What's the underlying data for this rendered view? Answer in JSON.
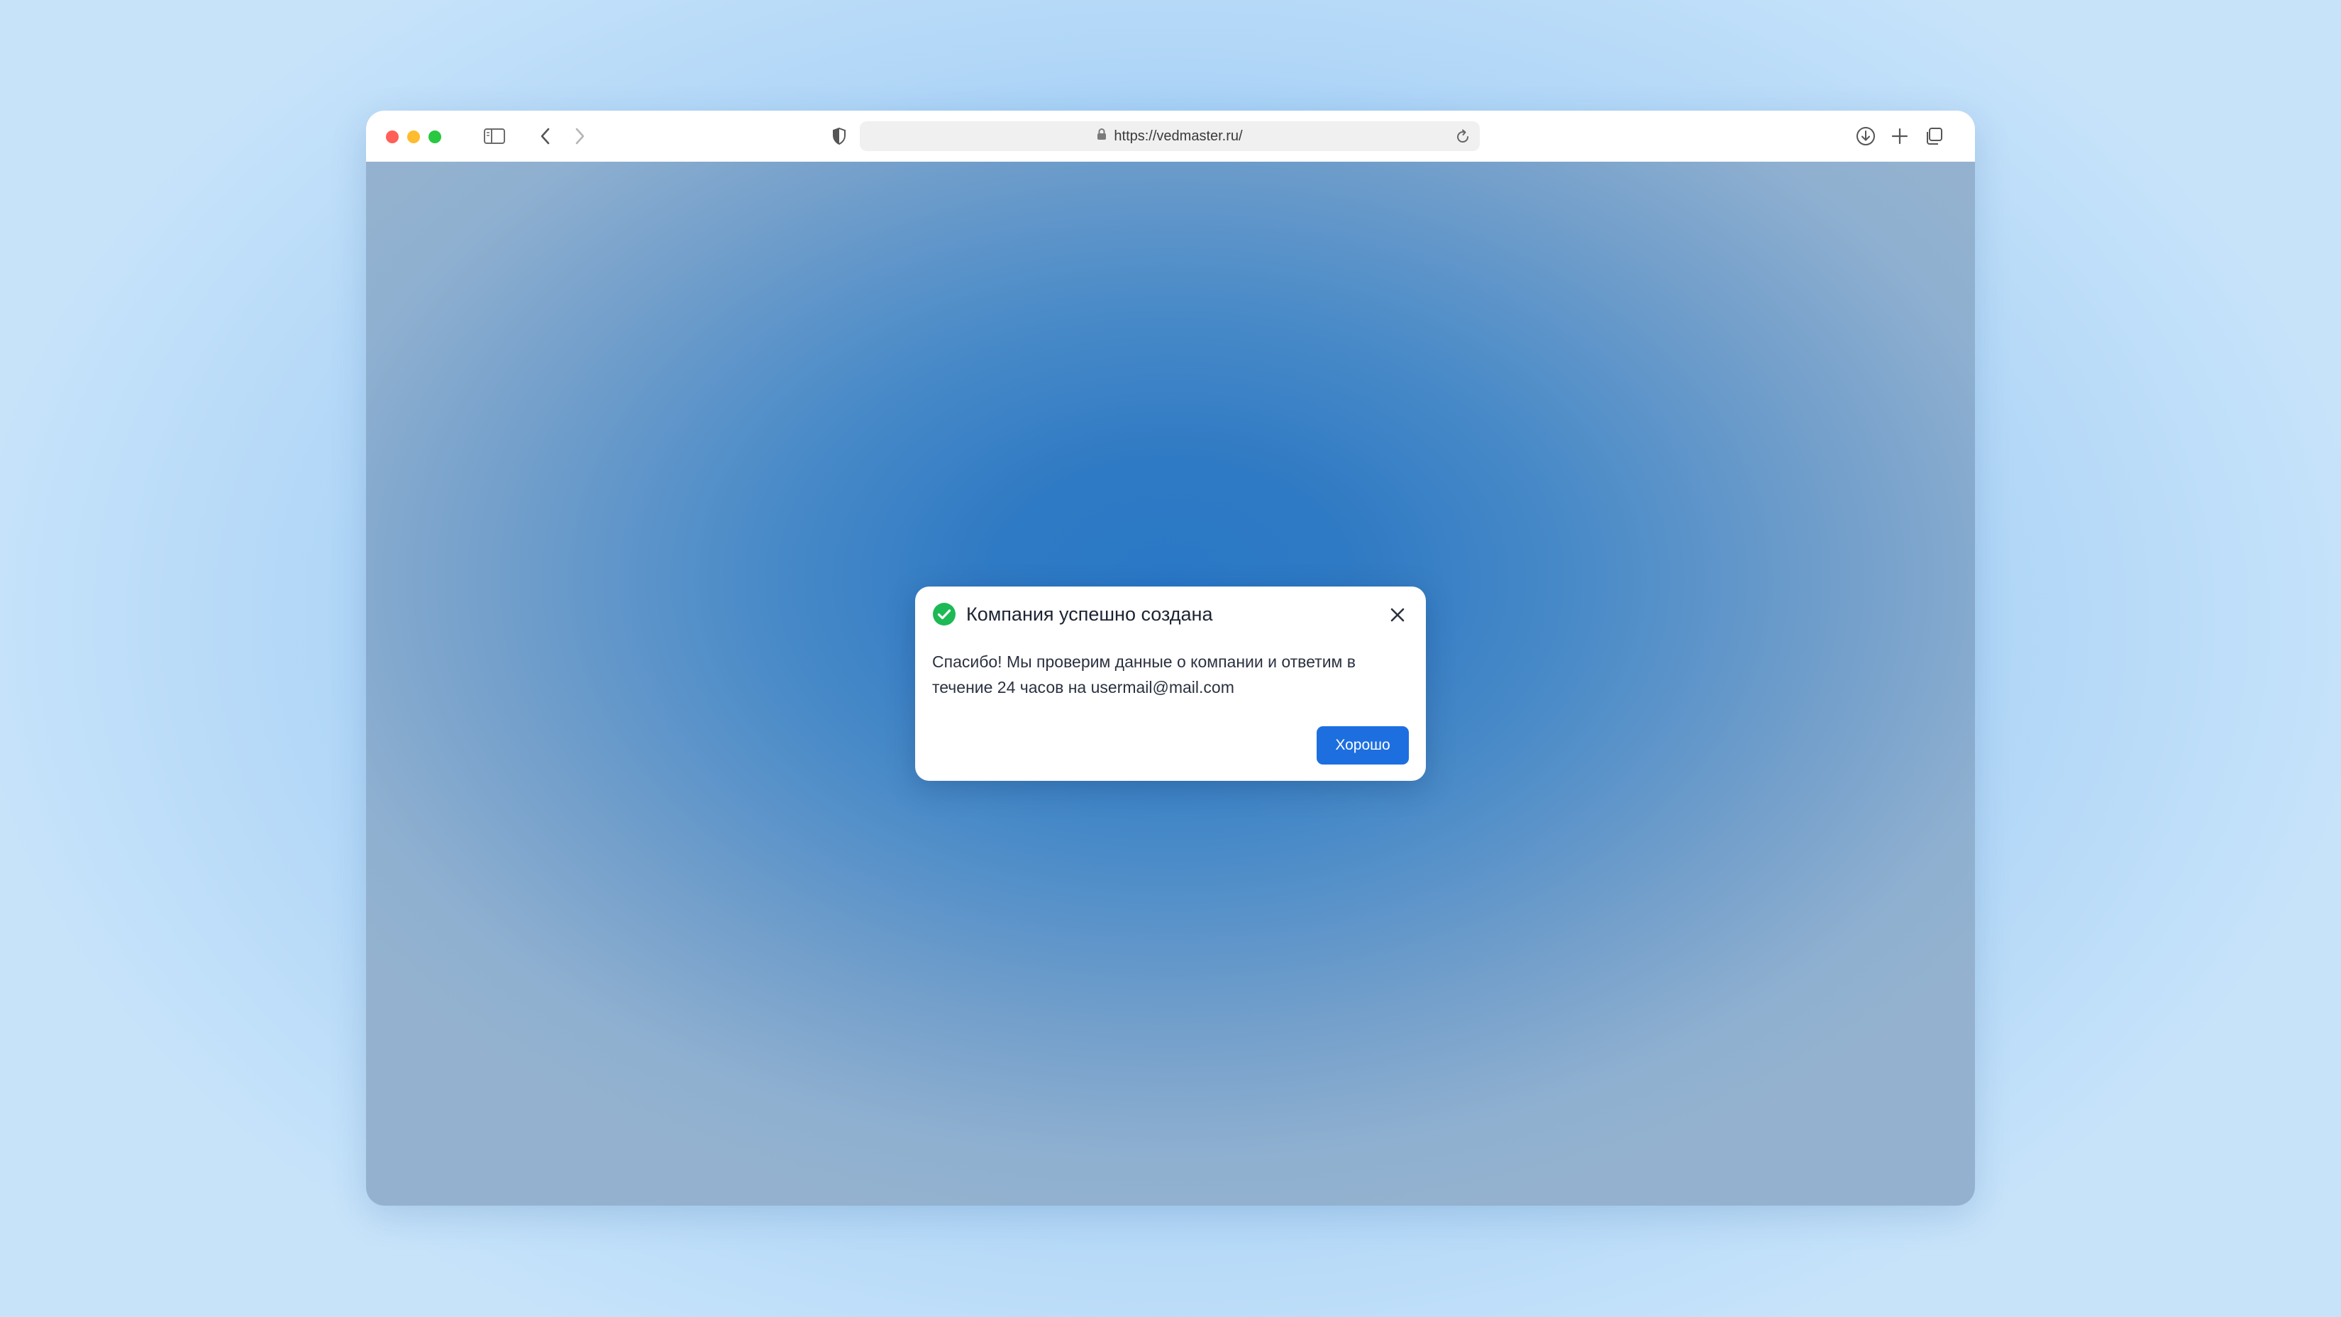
{
  "browser": {
    "url": "https://vedmaster.ru/",
    "traffic_lights": {
      "close_color": "#ff5f57",
      "minimize_color": "#febc2e",
      "zoom_color": "#28c840"
    },
    "toolbar_icons": [
      "sidebar-icon",
      "back-icon",
      "forward-icon",
      "shield-icon",
      "lock-icon",
      "reload-icon",
      "download-icon",
      "new-tab-icon",
      "tabs-overview-icon"
    ]
  },
  "dialog": {
    "title": "Компания успешно создана",
    "body": "Спасибо! Мы проверим данные о компании и ответим в течение 24 часов на usermail@mail.com",
    "button_label": "Хорошо",
    "icons": [
      "success-check-icon",
      "close-icon"
    ],
    "accent_color": "#1d6fe0",
    "success_color": "#1db954"
  }
}
